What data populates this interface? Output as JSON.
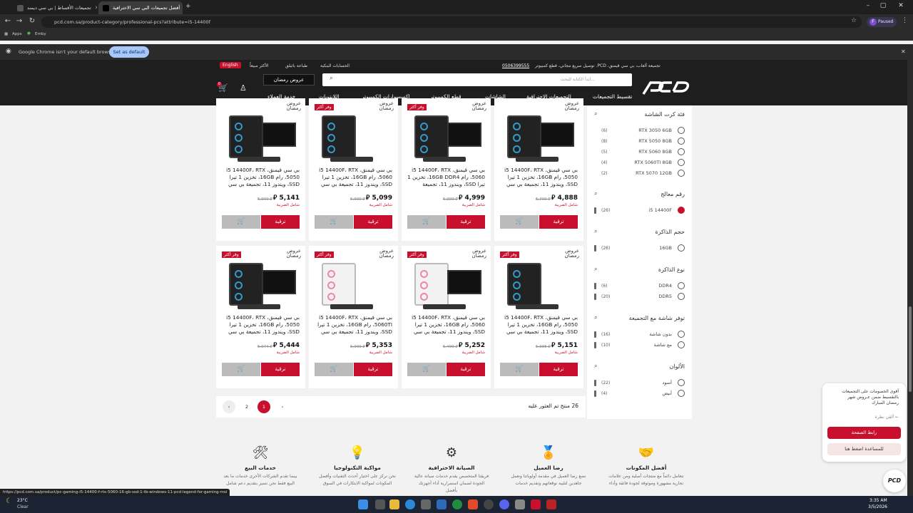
{
  "tabs": [
    {
      "title": "تجميعات الأقساط | بي سي ديمند"
    },
    {
      "title": "أفضل تجميعات البي سي الاحترافية"
    }
  ],
  "window": {
    "minimize": "–",
    "maximize": "▢",
    "close": "✕",
    "new_tab": "+"
  },
  "address": {
    "url": "pcd.com.sa/product-category/professional-pcs?attribute=i5-14400f",
    "profile": "Paused"
  },
  "bookmarks": {
    "apps": "Apps",
    "emby": "Emby"
  },
  "infobar": {
    "message": "Google Chrome isn't your default browser",
    "button": "Set as default",
    "close": "✕"
  },
  "site": {
    "top_strip": "تجميعة ألعاب، بي سي قيمنق، PCD. توصيل سريع مجاني، قطع كمبيوتر",
    "phone": "0506399555",
    "links": [
      "الحسابات البنكية",
      "طباعة باثيلق",
      "الأكثر مبيعاً"
    ],
    "lang": "English",
    "search_placeholder": "ابدأ الكتابة للبحث...",
    "ramadan": "عروض رمضان",
    "cart_count": "0",
    "logo": "PCD",
    "menu": [
      "تقسيط التجميعات",
      "التجميعات الاحترافية",
      "الشاشات",
      "قطع الكمبيوتر",
      "اكسسوارات الكمبيوتر",
      "اللابتوبات",
      "خدمة العملاء"
    ]
  },
  "filters": [
    {
      "title": "فئة كرت الشاشة",
      "options": [
        {
          "label": "RTX 3050 6GB",
          "count": "(6)"
        },
        {
          "label": "RTX 5050 8GB",
          "count": "(8)"
        },
        {
          "label": "RTX 5060 8GB",
          "count": "(5)"
        },
        {
          "label": "RTX 5060TI 8GB",
          "count": "(4)"
        },
        {
          "label": "RTX 5070 12GB",
          "count": "(2)"
        }
      ]
    },
    {
      "title": "رقم معالج",
      "options": [
        {
          "label": "i5 14400F",
          "count": "(26)",
          "checked": true
        }
      ]
    },
    {
      "title": "حجم الذاكرة",
      "options": [
        {
          "label": "16GB",
          "count": "(26)"
        }
      ]
    },
    {
      "title": "نوع الذاكرة",
      "options": [
        {
          "label": "DDR4",
          "count": "(6)"
        },
        {
          "label": "DDR5",
          "count": "(20)"
        }
      ]
    },
    {
      "title": "توفر شاشة مع التجميعة",
      "options": [
        {
          "label": "بدون شاشة",
          "count": "(16)"
        },
        {
          "label": "مع شاشة",
          "count": "(10)"
        }
      ]
    },
    {
      "title": "الألوان",
      "options": [
        {
          "label": "أسود",
          "count": "(22)"
        },
        {
          "label": "أبيض",
          "count": "(4)"
        }
      ]
    }
  ],
  "products": [
    {
      "name": "بي سي قيمنق، i5 14400F، RTX 5050، رام 16GB، تخزين 1 تيرا SSD، ويندوز 11، تجميعة بي سي",
      "price": "4,888 ⃁",
      "old": "5,700 ⃁",
      "tax": "شامل الضريبة",
      "badge": "",
      "white": false,
      "monitor": true
    },
    {
      "name": "بي سي قيمنق، i5 14400F، RTX 5060، رام 16GB DDR4، تخزين 1 تيرا SSD، ويندوز 11، تجميعة",
      "price": "4,999 ⃁",
      "old": "5,900 ⃁",
      "tax": "شامل الضريبة",
      "badge": "وفر أكثر",
      "white": false,
      "monitor": true
    },
    {
      "name": "بي سي قيمنق، i5 14400F، RTX 5060، رام 16GB، تخزين 1 تيرا SSD، ويندوز 11، تجميعة بي سي",
      "price": "5,099 ⃁",
      "old": "5,900 ⃁",
      "tax": "شامل الضريبة",
      "badge": "وفر أكثر",
      "white": false,
      "monitor": false
    },
    {
      "name": "بي سي قيمنق، i5 14400F، RTX 5050، رام 16GB، تخزين 1 تيرا SSD، ويندوز 11، تجميعة بي سي",
      "price": "5,141 ⃁",
      "old": "5,900 ⃁",
      "tax": "شامل الضريبة",
      "badge": "",
      "white": false,
      "monitor": true
    },
    {
      "name": "بي سي قيمنق، i5 14400F، RTX 5050، رام 16GB، تخزين 1 تيرا SSD، ويندوز 11، تجميعة بي سي",
      "price": "5,151 ⃁",
      "old": "5,995 ⃁",
      "tax": "شامل الضريبة",
      "badge": "وفر أكثر",
      "white": false,
      "monitor": false
    },
    {
      "name": "بي سي قيمنق، i5 14400F، RTX 5060، رام 16GB، تخزين 1 تيرا SSD، ويندوز 11، تجميعة بي سي",
      "price": "5,252 ⃁",
      "old": "5,499 ⃁",
      "tax": "شامل الضريبة",
      "badge": "وفر أكثر",
      "white": true,
      "monitor": true
    },
    {
      "name": "بي سي قيمنق، i5 14400F، RTX 5060TI، رام 16GB، تخزين 1 تيرا SSD، ويندوز 11، تجميعة بي سي",
      "price": "5,353 ⃁",
      "old": "5,999 ⃁",
      "tax": "شامل الضريبة",
      "badge": "وفر أكثر",
      "white": true,
      "monitor": false
    },
    {
      "name": "بي سي قيمنق، i5 14400F، RTX 5050، رام 16GB، تخزين 1 تيرا SSD، ويندوز 11، تجميعة بي سي",
      "price": "5,444 ⃁",
      "old": "5,974 ⃁",
      "tax": "شامل الضريبة",
      "badge": "وفر أكثر",
      "white": false,
      "monitor": true
    }
  ],
  "product_buttons": {
    "upgrade": "ترقية",
    "cart": "🛒"
  },
  "results_text": "26 منتج تم العثور عليه",
  "pager": {
    "prev": "‹",
    "p1": "1",
    "p2": "2",
    "next": "›"
  },
  "features": [
    {
      "title": "أفضل المكونات",
      "desc": "نتعامل دائماً مع منتجات أصلية ومن علامات تجارية مشهورة وموثوقة لجودة فائقة وأداء",
      "icon": "🤝"
    },
    {
      "title": "رضا العميل",
      "desc": "نضع رضا العميل في مقدمة أولوياتنا ونعمل جاهدين لتلبية توقعاتهم وتقديم خدمات",
      "icon": "🏅"
    },
    {
      "title": "الصيانة الاحترافية",
      "desc": "فريقنا المتخصص يقدم خدمات صيانة عالية الجودة لضمان استمرارية أداء أجهزتك بأفضل",
      "icon": "⚙"
    },
    {
      "title": "مواكبة التكنولوجيا",
      "desc": "نحن نركز على اختيار أحدث التقنيات وأفضل المكونات لمواكبة الابتكارات في السوق",
      "icon": "💡"
    },
    {
      "title": "خدمات البيع",
      "desc": "بينما تقدم الشركات الأخرى خدمات ما بعد البيع فقط نحن نتميز بتقديم دعم شامل",
      "icon": "🛠"
    }
  ],
  "popup": {
    "text": "أقوى الخصومات على التجميعات بالتقسيط ضمن عـروض شهر رمضان المبارك",
    "sub": "ألقي نظرة ←",
    "btn1": "رابط الصفحة",
    "btn2": "للمساعدة اضغط هنا"
  },
  "chat_logo": "PCD",
  "status_url": "https://pcd.com.sa/product/pc-gaming-i5-14400-f-rtx-5060-16-gb-ssd-1-tb-windows-11-pcd-legend-for-gaming-msi",
  "taskbar": {
    "weather_temp": "23°C",
    "weather_text": "Clear",
    "time": "3:35 AM",
    "date": "3/5/2026"
  }
}
